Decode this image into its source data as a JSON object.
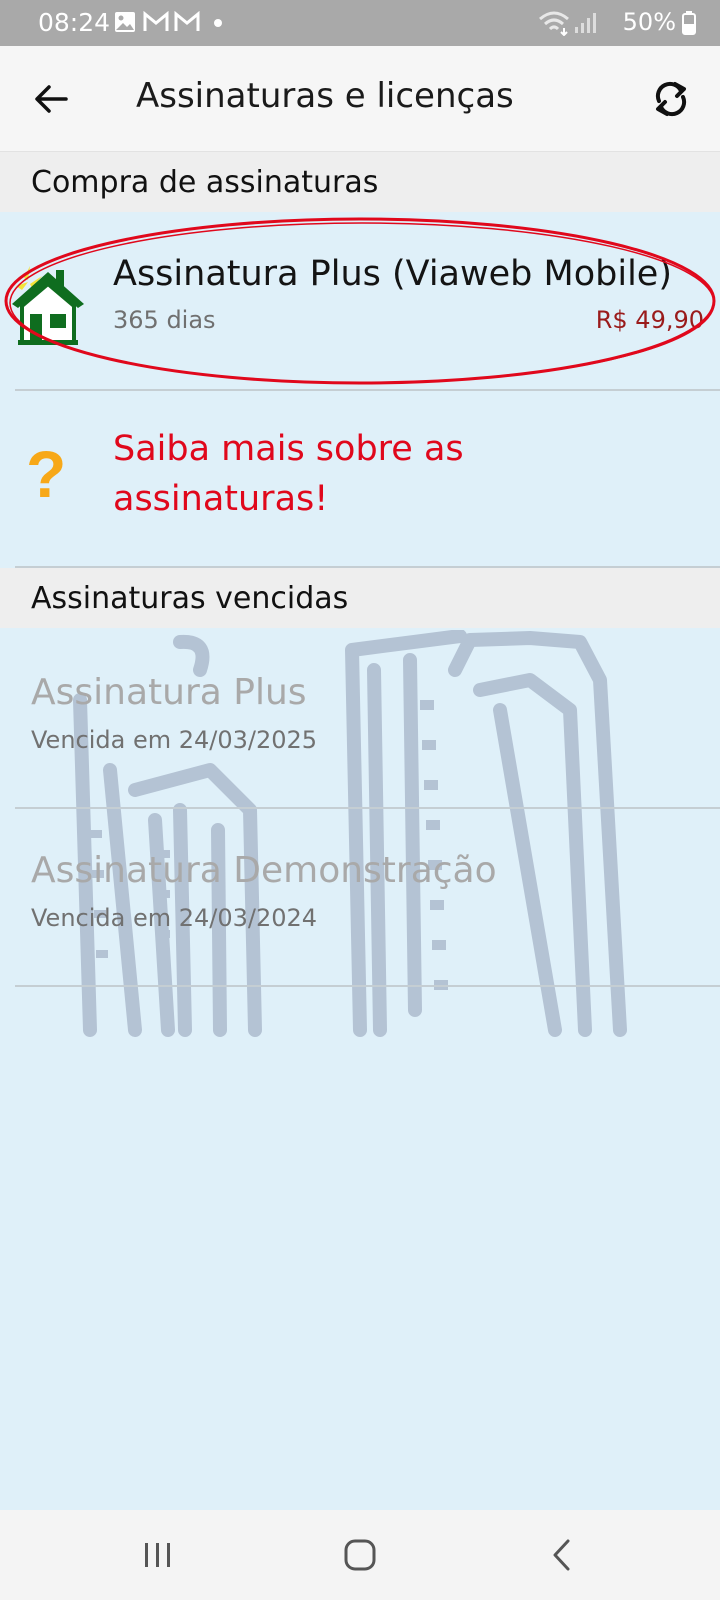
{
  "status_bar": {
    "time": "08:24",
    "battery": "50%",
    "icons": [
      "gallery-icon",
      "gmail-icon",
      "gmail-icon",
      "dot-icon",
      "wifi-icon",
      "signal-icon",
      "battery-icon"
    ]
  },
  "app_bar": {
    "title": "Assinaturas e licenças",
    "back_icon": "arrow-left-icon",
    "refresh_icon": "refresh-icon"
  },
  "purchase_section": {
    "header": "Compra de assinaturas",
    "items": [
      {
        "name": "Assinatura Plus (Viaweb Mobile)",
        "duration": "365 dias",
        "price": "R$ 49,90",
        "icon": "house-icon"
      }
    ],
    "info_link": "Saiba mais sobre as assinaturas!",
    "info_icon": "question-icon",
    "highlight_color": "#e0081c"
  },
  "expired_section": {
    "header": "Assinaturas vencidas",
    "items": [
      {
        "name": "Assinatura Plus",
        "expired": "Vencida em 24/03/2025"
      },
      {
        "name": "Assinatura Demonstração",
        "expired": "Vencida em 24/03/2024"
      }
    ]
  },
  "nav_bar": {
    "icons": [
      "recents-icon",
      "home-icon",
      "back-icon"
    ]
  },
  "colors": {
    "background": "#dff0f9",
    "price": "#9a1b1b",
    "info_text": "#e0081c",
    "question": "#f7a818",
    "house": "#0f6d1f"
  }
}
